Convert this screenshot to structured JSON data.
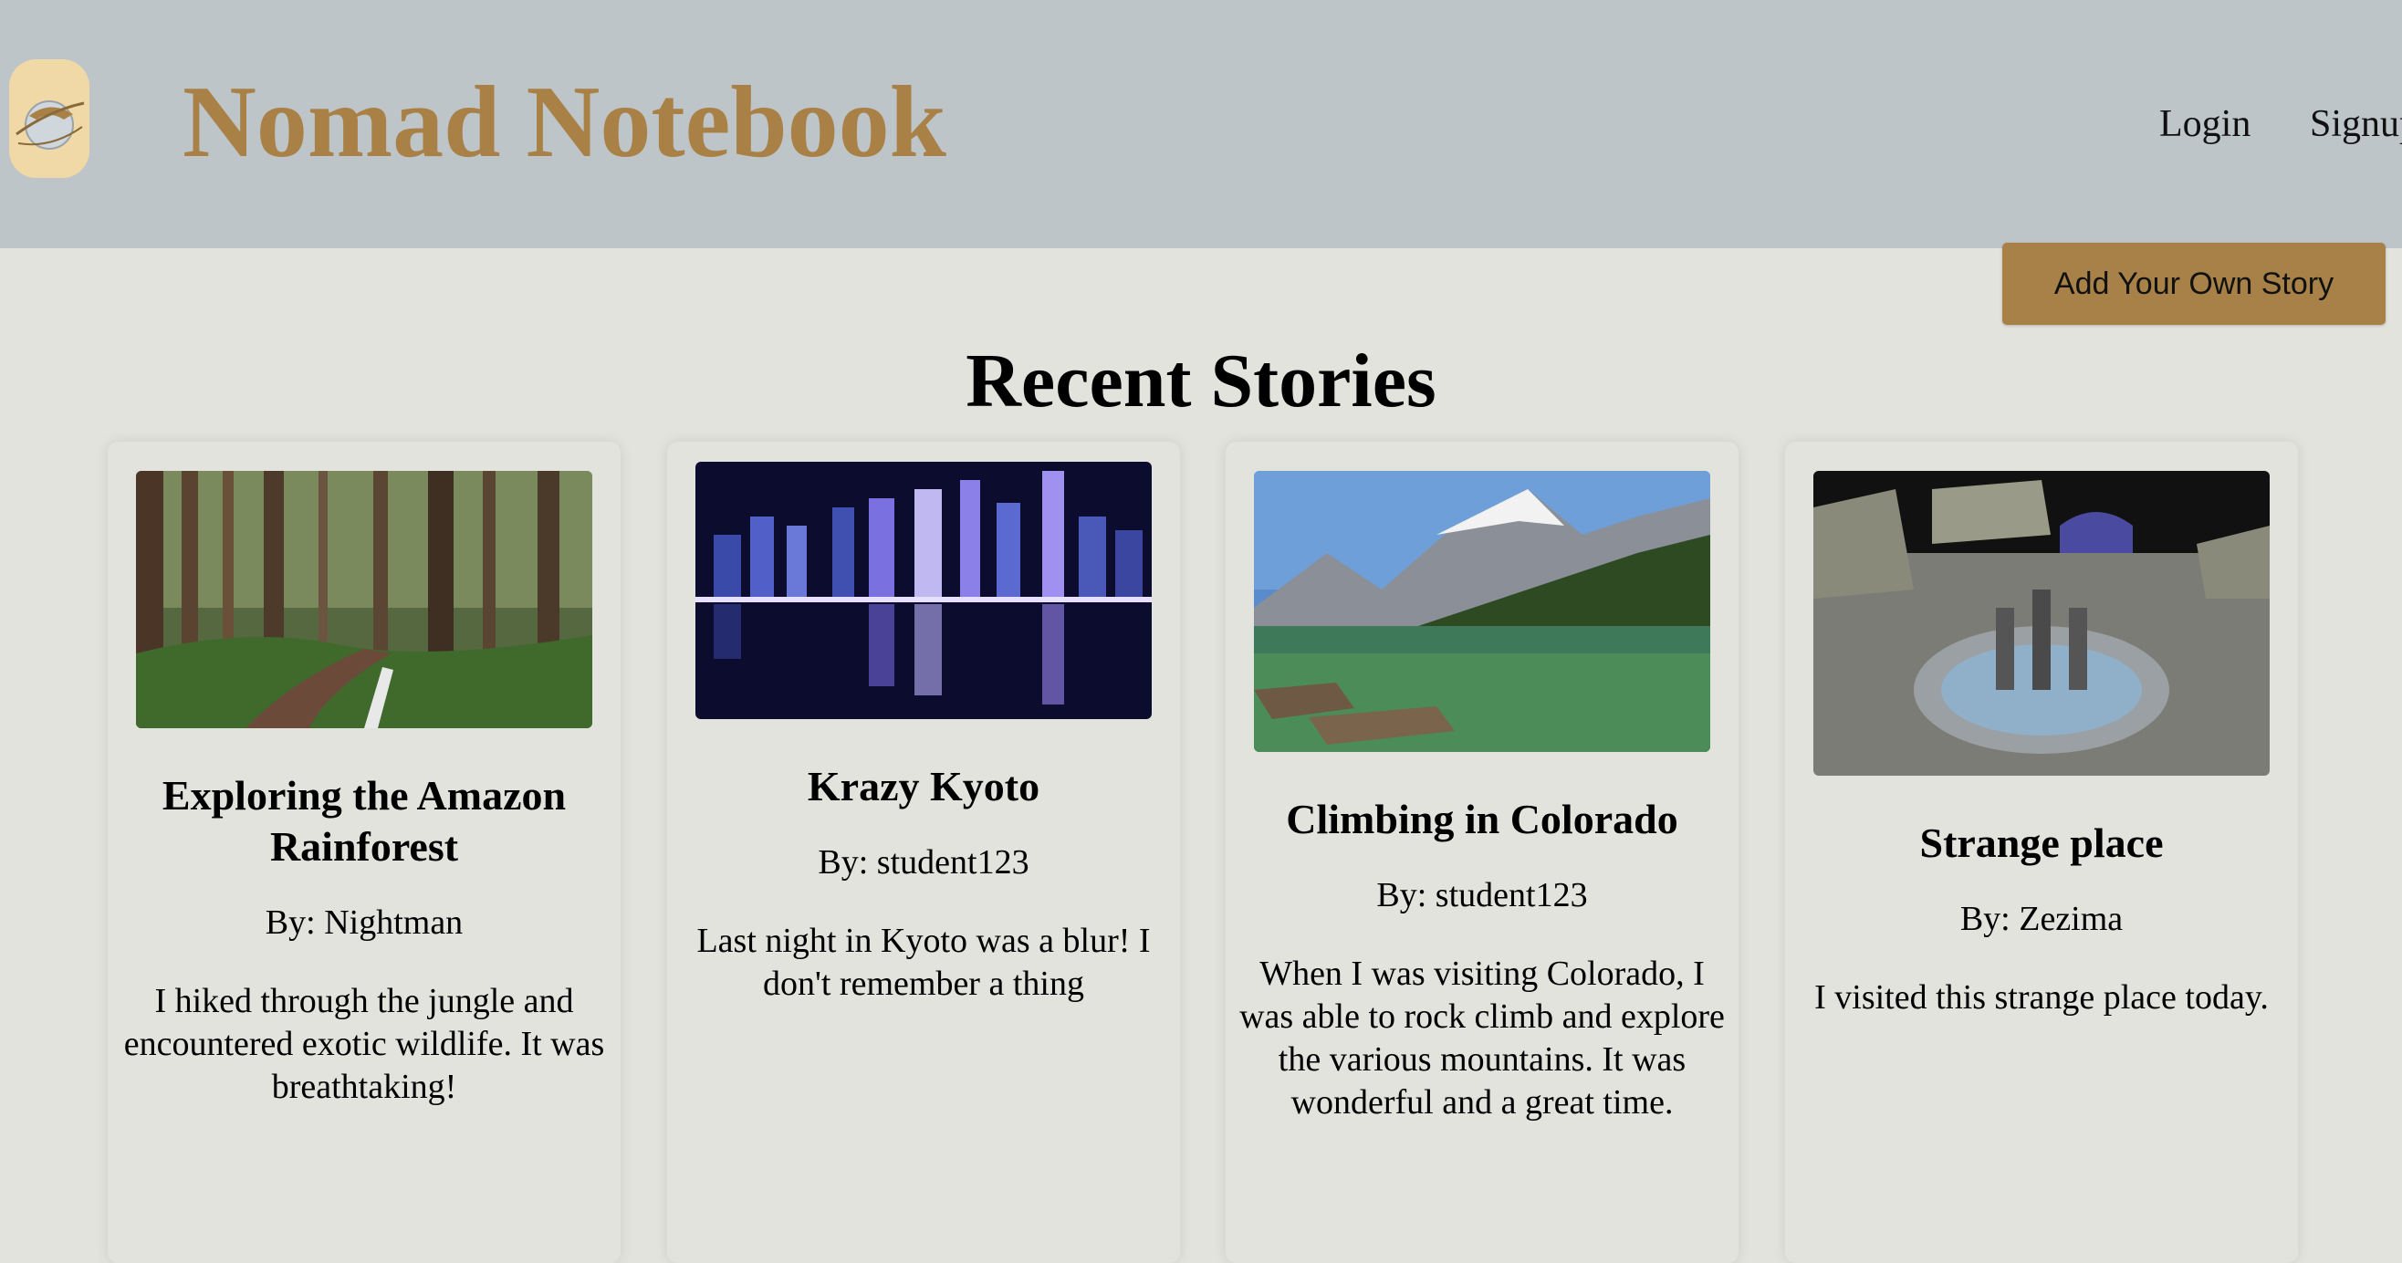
{
  "header": {
    "site_title": "Nomad Notebook",
    "nav": {
      "login": "Login",
      "signup": "Signup"
    }
  },
  "actions": {
    "add_story": "Add Your Own Story"
  },
  "section_title": "Recent Stories",
  "stories": [
    {
      "title": "Exploring the Amazon Rainforest",
      "author": "By: Nightman",
      "body": "I hiked through the jungle and encountered exotic wildlife. It was breathtaking!"
    },
    {
      "title": "Krazy Kyoto",
      "author": "By: student123",
      "body": "Last night in Kyoto was a blur! I don't remember a thing"
    },
    {
      "title": "Climbing in Colorado",
      "author": "By: student123",
      "body": "When I was visiting Colorado, I was able to rock climb and explore the various mountains. It was wonderful and a great time."
    },
    {
      "title": "Strange place",
      "author": "By: Zezima",
      "body": "I visited this strange place today."
    }
  ],
  "colors": {
    "header_bg": "#bec5c8",
    "page_bg": "#e3e3de",
    "brand": "#a98147",
    "button": "#a88148"
  }
}
